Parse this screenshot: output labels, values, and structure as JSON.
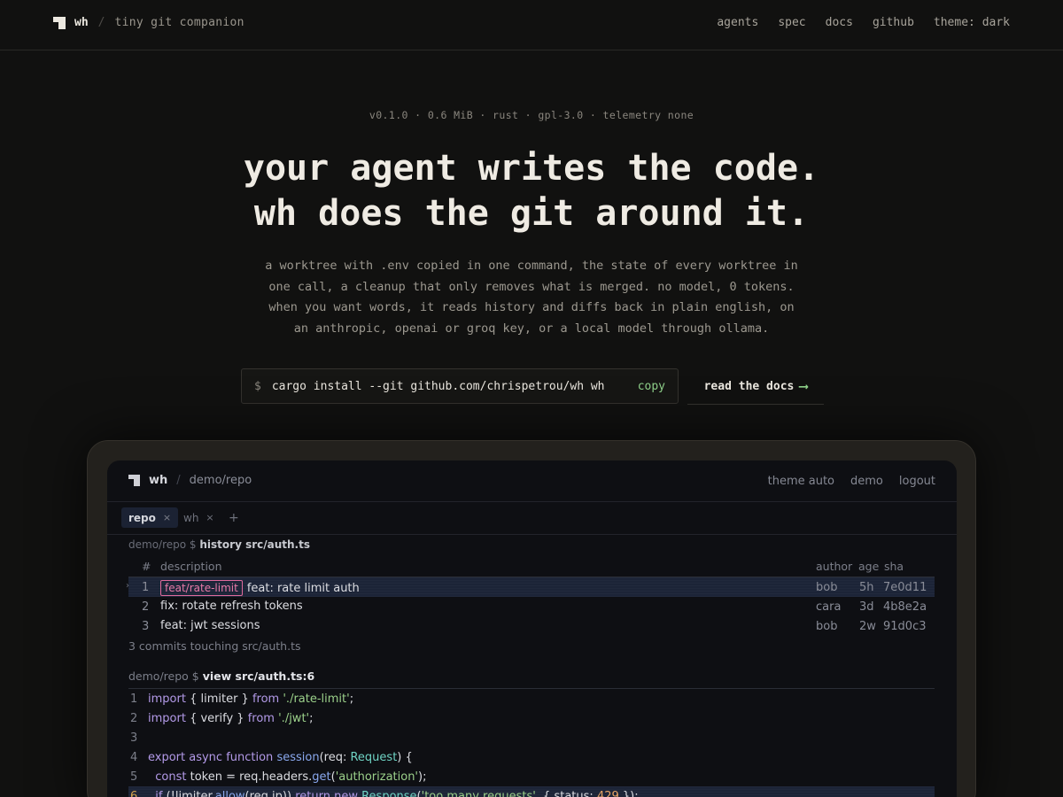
{
  "site": {
    "name": "wh",
    "tagline": "tiny git companion",
    "nav": [
      "agents",
      "spec",
      "docs",
      "github",
      "theme: dark"
    ]
  },
  "hero": {
    "meta": "v0.1.0 · 0.6 MiB · rust · gpl-3.0 · telemetry none",
    "headline_1": "your agent writes the code.",
    "headline_2": "wh does the git around it.",
    "sub_1": "a worktree with .env copied in one command, the state of every worktree in",
    "sub_2": "one call, a cleanup that only removes what is merged. no model, 0 tokens.",
    "sub_3": "when you want words, it reads history and diffs back in plain english, on",
    "sub_4": "an anthropic, openai or groq key, or a local model through ollama.",
    "install_prompt": "$",
    "install_command": "cargo install --git github.com/chrispetrou/wh wh",
    "copy_label": "copy",
    "docs_label": "read the docs",
    "docs_arrow": "⟶"
  },
  "demo": {
    "brand": "wh",
    "repo": "demo/repo",
    "nav": [
      "theme auto",
      "demo",
      "logout"
    ],
    "tabs": [
      {
        "label": "repo",
        "close": "×"
      },
      {
        "label": "wh",
        "close": "×"
      }
    ],
    "add_tab": "+",
    "clipped_path": "demo/repo $",
    "clipped_cmd": "history src/auth.ts",
    "table_head": {
      "num": "#",
      "desc": "description",
      "author": "author",
      "age": "age",
      "sha": "sha"
    },
    "commits": [
      {
        "num": "1",
        "branch": "feat/rate-limit",
        "desc": "feat: rate limit auth",
        "author": "bob",
        "age": "5h",
        "sha": "7e0d11"
      },
      {
        "num": "2",
        "branch": "",
        "desc": "fix: rotate refresh tokens",
        "author": "cara",
        "age": "3d",
        "sha": "4b8e2a"
      },
      {
        "num": "3",
        "branch": "",
        "desc": "feat: jwt sessions",
        "author": "bob",
        "age": "2w",
        "sha": "91d0c3"
      }
    ],
    "commits_summary": "3 commits touching src/auth.ts",
    "view_prompt": "demo/repo $",
    "view_cmd": "view src/auth.ts:6",
    "code": {
      "l1": {
        "n": "1",
        "kw": "import",
        "a": " { limiter } ",
        "kw2": "from",
        "str": "'./rate-limit'",
        "end": ";"
      },
      "l2": {
        "n": "2",
        "kw": "import",
        "a": " { verify } ",
        "kw2": "from",
        "str": "'./jwt'",
        "end": ";"
      },
      "l3": {
        "n": "3"
      },
      "l4": {
        "n": "4",
        "kw": "export async function",
        "fn": "session",
        "a": "(req: ",
        "ty": "Request",
        "end": ") {"
      },
      "l5": {
        "n": "5",
        "kw": "const",
        "a": " token = req.headers.",
        "fn": "get",
        "b": "(",
        "str": "'authorization'",
        "end": ");"
      },
      "l6": {
        "n": "6",
        "kw": "if",
        "a": " (!limiter.",
        "fn": "allow",
        "b": "(req.ip)) ",
        "kw2": "return new",
        "ty": "Response",
        "c": "(",
        "str": "'too many requests'",
        "d": ", { status: ",
        "num": "429",
        "end": " });"
      }
    }
  }
}
